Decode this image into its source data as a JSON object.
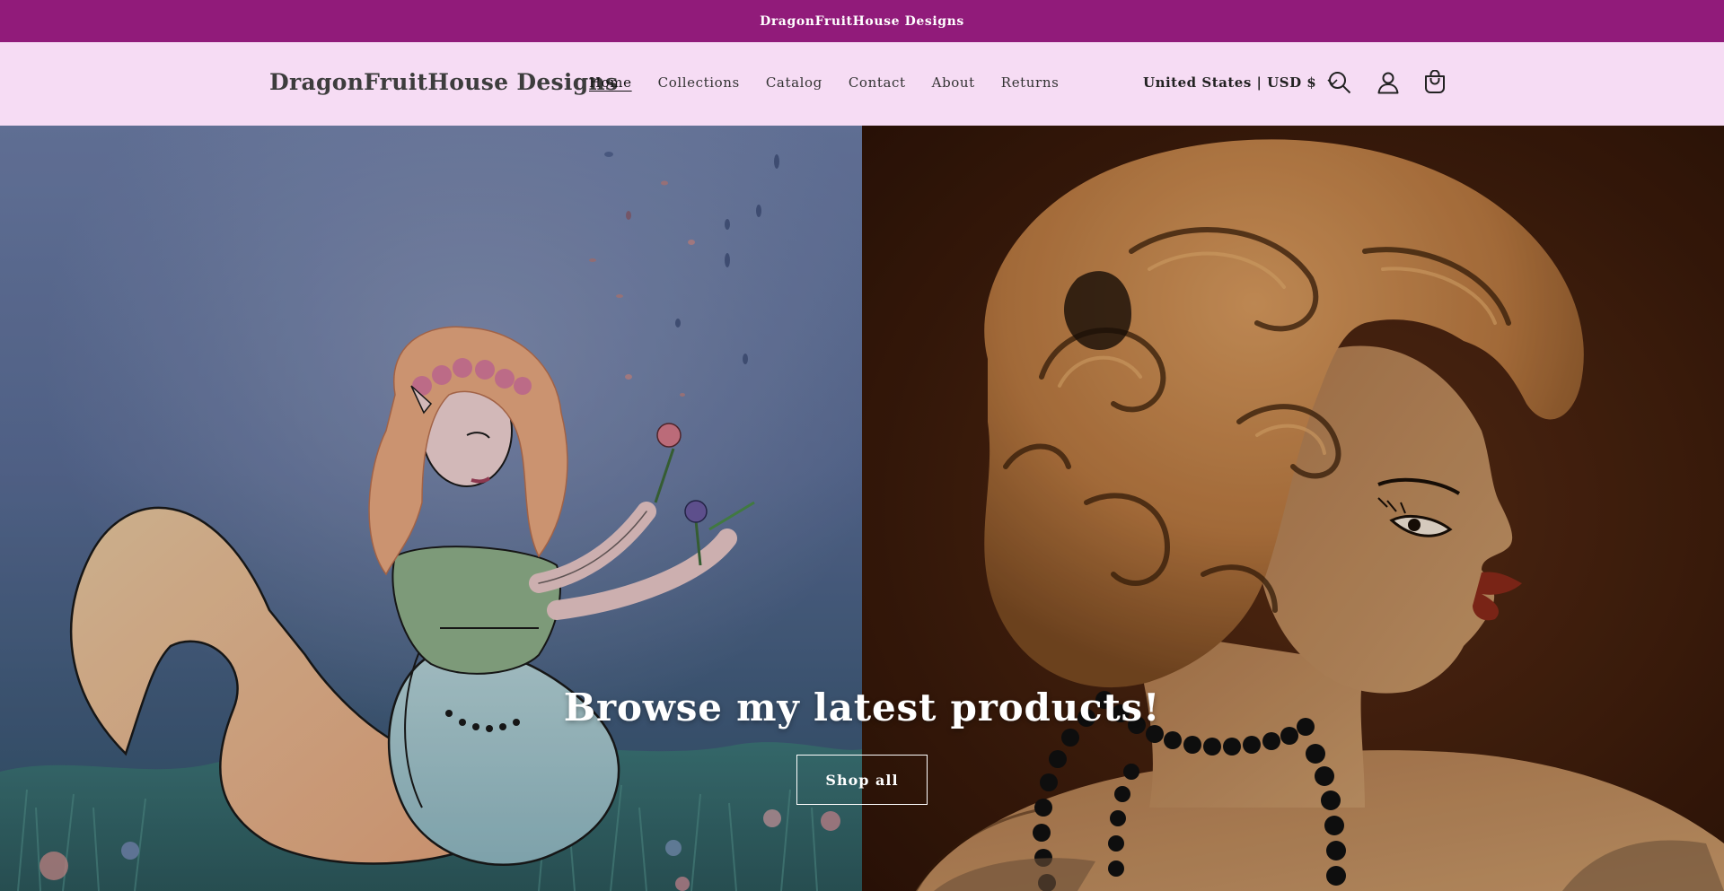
{
  "announcement": {
    "text": "DragonFruitHouse Designs"
  },
  "header": {
    "logo": "DragonFruitHouse Designs",
    "nav": [
      {
        "label": "Home",
        "active": true
      },
      {
        "label": "Collections"
      },
      {
        "label": "Catalog"
      },
      {
        "label": "Contact"
      },
      {
        "label": "About"
      },
      {
        "label": "Returns"
      }
    ],
    "locale": "United States | USD $",
    "icons": [
      "search-icon",
      "account-icon",
      "cart-icon"
    ]
  },
  "hero": {
    "title": "Browse my latest products!",
    "button_label": "Shop all",
    "left_image": "mermaid-illustration",
    "right_image": "flapper-portrait-illustration"
  },
  "colors": {
    "announcement_bg": "#911b7a",
    "header_bg": "#f6dcf4"
  }
}
